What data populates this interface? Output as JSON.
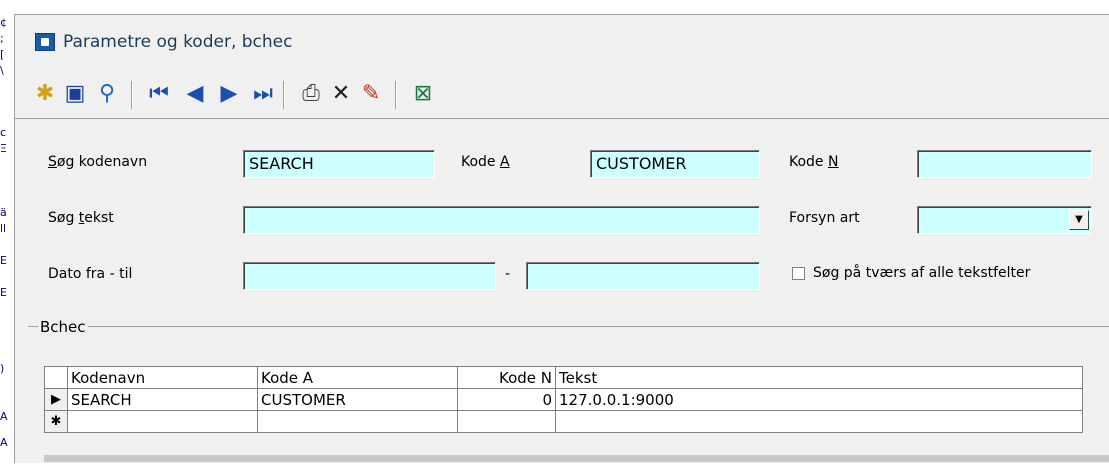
{
  "window": {
    "title": "Parametre og koder, bchec"
  },
  "toolbar": {
    "buttons": [
      {
        "name": "new-record-icon",
        "glyph": "✱",
        "color": "#d4a017"
      },
      {
        "name": "save-icon",
        "glyph": "▣",
        "color": "#1a3e9a"
      },
      {
        "name": "search-icon",
        "glyph": "⚲",
        "color": "#2a6ab8"
      },
      {
        "name": "first-record-icon",
        "glyph": "⏮",
        "color": "#1a4fb0"
      },
      {
        "name": "previous-record-icon",
        "glyph": "◀",
        "color": "#1a4fb0"
      },
      {
        "name": "next-record-icon",
        "glyph": "▶",
        "color": "#1a4fb0"
      },
      {
        "name": "last-record-icon",
        "glyph": "⏭",
        "color": "#1a4fb0"
      },
      {
        "name": "print-icon",
        "glyph": "⎙",
        "color": "#404040"
      },
      {
        "name": "delete-icon",
        "glyph": "✕",
        "color": "#202020"
      },
      {
        "name": "edit-icon",
        "glyph": "✎",
        "color": "#c03020"
      },
      {
        "name": "excel-export-icon",
        "glyph": "⊠",
        "color": "#1e7a3a"
      }
    ]
  },
  "filters": {
    "search_name": {
      "label_pre": "",
      "label_u": "S",
      "label_post": "øg kodenavn",
      "value": "SEARCH"
    },
    "code_a": {
      "label_pre": "Kode ",
      "label_u": "A",
      "label_post": "",
      "value": "CUSTOMER"
    },
    "code_n": {
      "label_pre": "Kode ",
      "label_u": "N",
      "label_post": "",
      "value": ""
    },
    "search_text": {
      "label_pre": "Søg ",
      "label_u": "t",
      "label_post": "ekst",
      "value": ""
    },
    "forsyn_art": {
      "label": "Forsyn art",
      "value": ""
    },
    "date_range": {
      "label": "Dato fra - til",
      "from": "",
      "separator": "-",
      "to": ""
    },
    "search_all": {
      "label": "Søg på tværs af alle tekstfelter",
      "checked": false
    }
  },
  "grid": {
    "group_label": "Bchec",
    "columns": [
      "Kodenavn",
      "Kode A",
      "Kode N",
      "Tekst"
    ],
    "rows": [
      {
        "indicator": "▶",
        "kodenavn": "SEARCH",
        "kode_a": "CUSTOMER",
        "kode_n": "0",
        "tekst": "127.0.0.1:9000"
      }
    ],
    "new_row_indicator": "✱"
  },
  "colors": {
    "field_bg": "#ccffff",
    "window_bg": "#f0f0f0"
  }
}
